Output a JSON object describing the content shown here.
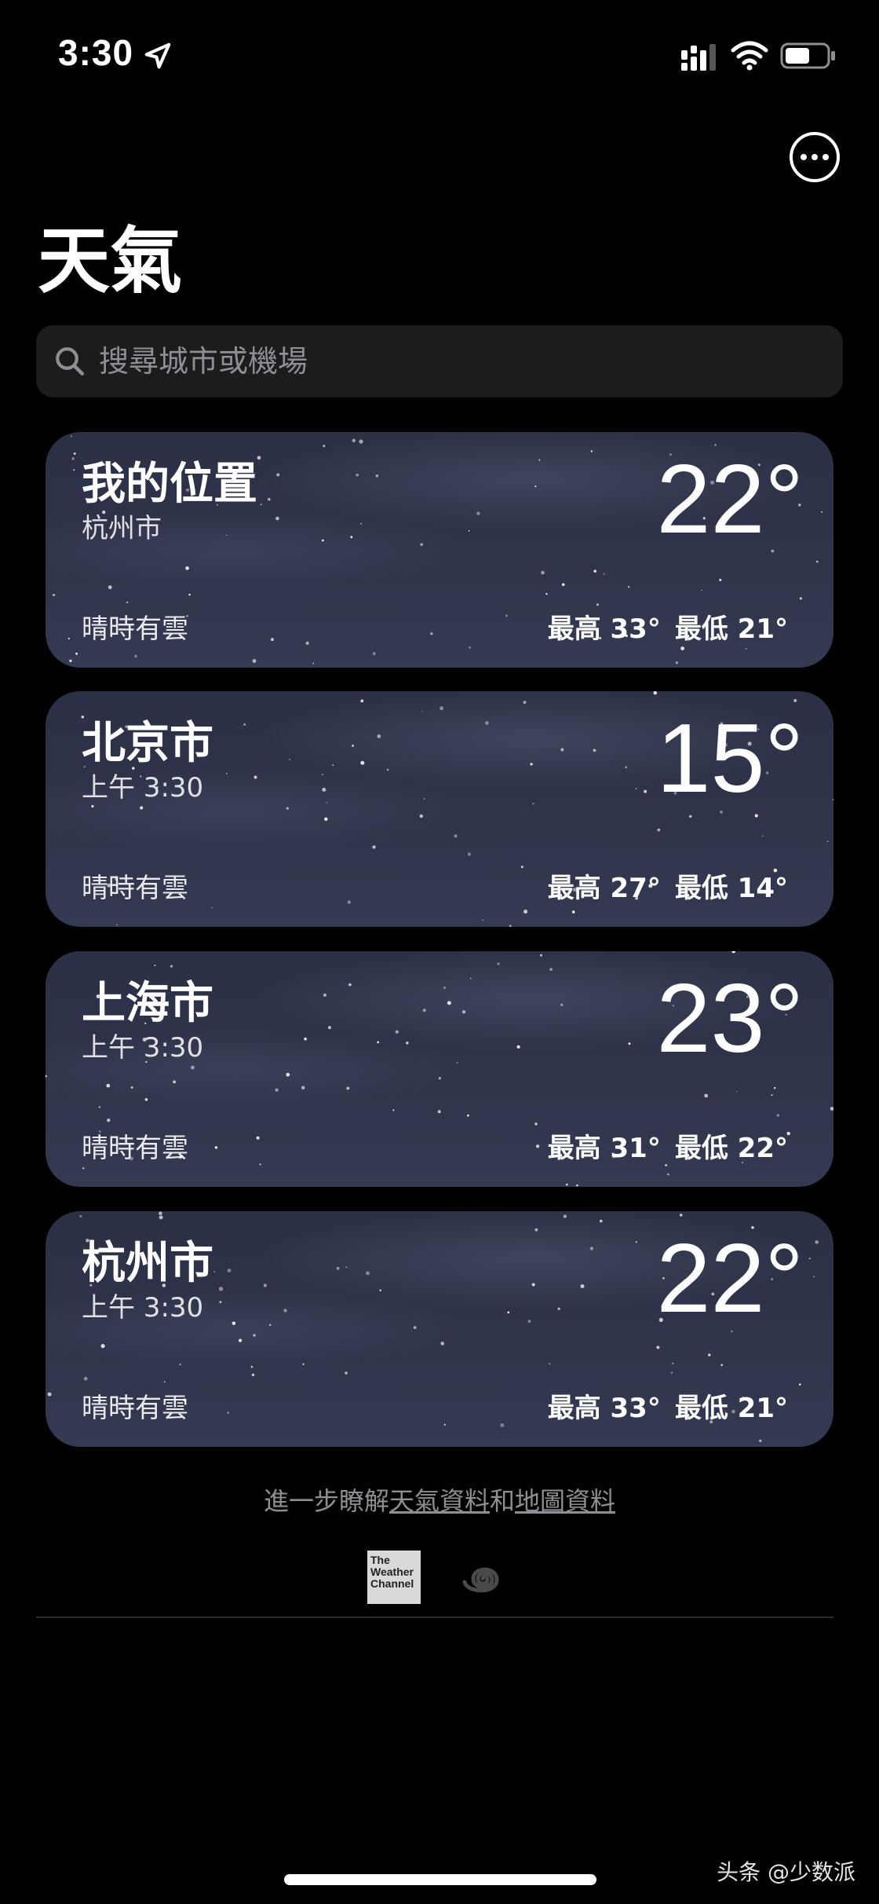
{
  "status_bar": {
    "time": "3:30",
    "location_icon": "location-arrow-icon",
    "signal_icon": "cellular-signal-icon",
    "wifi_icon": "wifi-icon",
    "battery_icon": "battery-icon"
  },
  "header": {
    "more_icon": "ellipsis-circle-icon",
    "title": "天氣"
  },
  "search": {
    "icon": "search-icon",
    "placeholder": "搜尋城市或機場"
  },
  "cities": [
    {
      "name": "我的位置",
      "subtitle": "杭州市",
      "temperature": "22°",
      "condition": "晴時有雲",
      "high": "最高 33°",
      "low": "最低 21°"
    },
    {
      "name": "北京市",
      "subtitle": "上午 3:30",
      "temperature": "15°",
      "condition": "晴時有雲",
      "high": "最高 27°",
      "low": "最低 14°"
    },
    {
      "name": "上海市",
      "subtitle": "上午 3:30",
      "temperature": "23°",
      "condition": "晴時有雲",
      "high": "最高 31°",
      "low": "最低 22°"
    },
    {
      "name": "杭州市",
      "subtitle": "上午 3:30",
      "temperature": "22°",
      "condition": "晴時有雲",
      "high": "最高 33°",
      "low": "最低 21°"
    }
  ],
  "footer": {
    "prefix": "進一步瞭解",
    "weather_data_link": "天氣資料",
    "conjunction": "和",
    "map_data_link": "地圖資料",
    "twc_logo_text": "The Weather Channel",
    "swirl_logo_icon": "swirl-logo-icon"
  },
  "watermark": "头条 @少数派",
  "colors": {
    "background": "#000000",
    "card": "#2f344b",
    "search_field": "#1c1c1e",
    "secondary_text": "#8e8e93"
  }
}
